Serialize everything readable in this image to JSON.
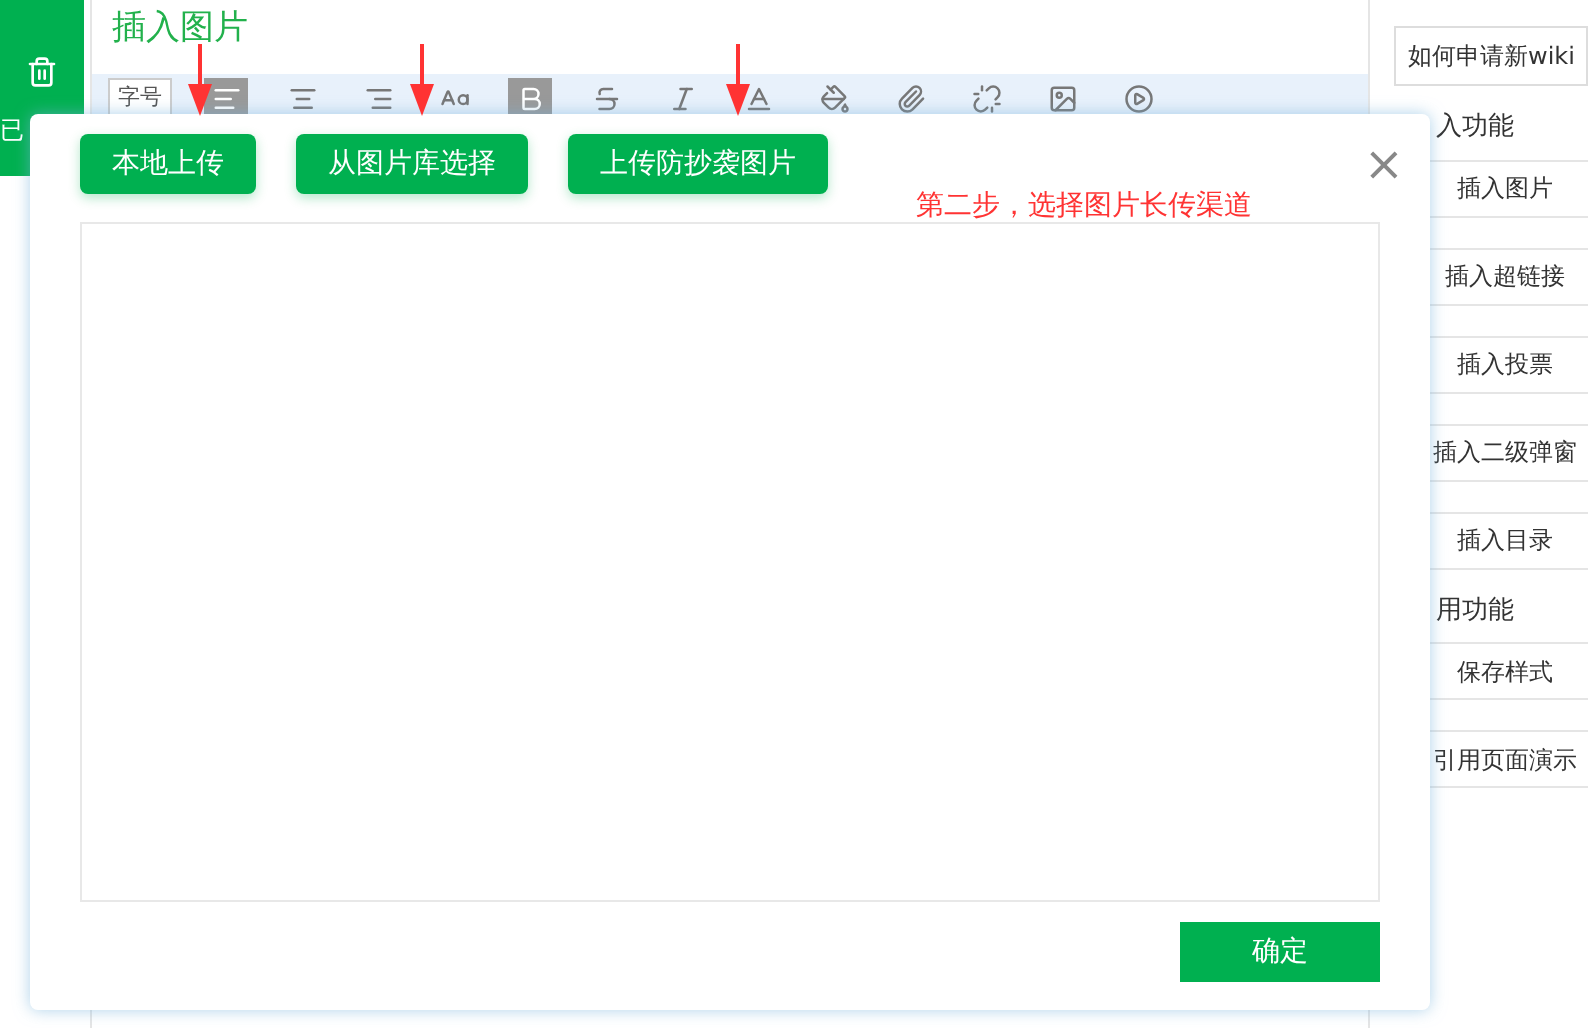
{
  "sidebar": {
    "label": "已"
  },
  "editor": {
    "title": "插入图片",
    "font_size": "字号",
    "tools": [
      {
        "kind": "align-left",
        "selected": true
      },
      {
        "kind": "align-center",
        "selected": false
      },
      {
        "kind": "align-right",
        "selected": false
      },
      {
        "kind": "font-size",
        "selected": false
      },
      {
        "kind": "bold",
        "selected": true
      },
      {
        "kind": "strikethrough",
        "selected": false
      },
      {
        "kind": "italic",
        "selected": false
      },
      {
        "kind": "font-color",
        "selected": false
      },
      {
        "kind": "fill",
        "selected": false
      },
      {
        "kind": "link",
        "selected": false
      },
      {
        "kind": "unlink",
        "selected": false
      },
      {
        "kind": "image",
        "selected": false
      },
      {
        "kind": "video",
        "selected": false
      }
    ]
  },
  "right_panel": {
    "search": {
      "value": "如何申请新wiki"
    },
    "sections": [
      {
        "title": "入功能",
        "items": [
          "插入图片",
          "插入超链接",
          "插入投票",
          "插入二级弹窗",
          "插入目录"
        ]
      },
      {
        "title": "用功能",
        "items": [
          "保存样式",
          "引用页面演示"
        ]
      }
    ]
  },
  "dialog": {
    "tabs": [
      "本地上传",
      "从图片库选择",
      "上传防抄袭图片"
    ],
    "close": "×",
    "note": "第二步，选择图片长传渠道",
    "confirm": "确定"
  }
}
